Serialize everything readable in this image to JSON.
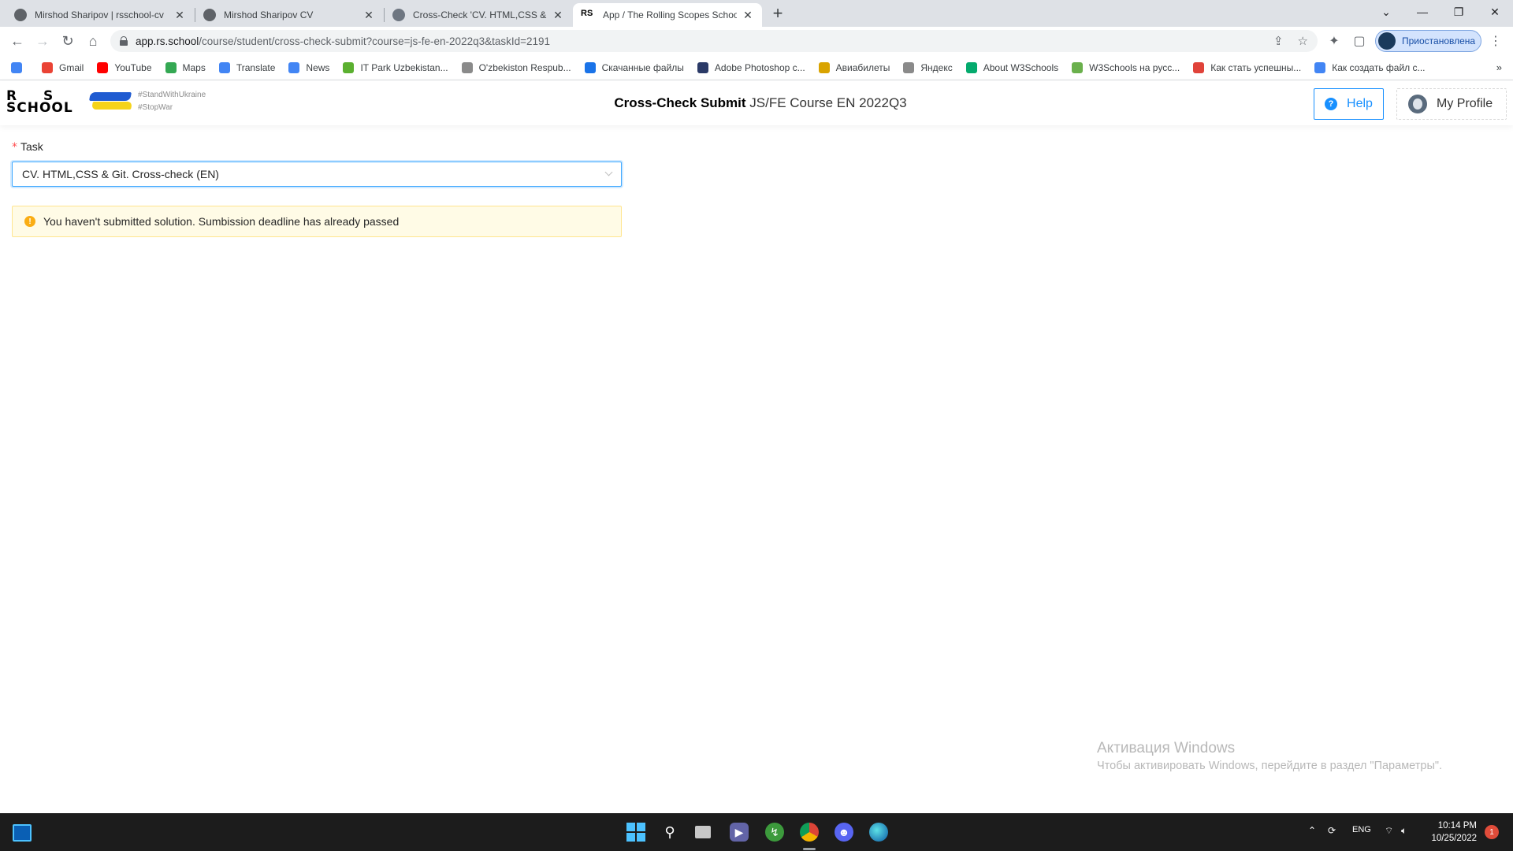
{
  "browser": {
    "tabs": [
      {
        "title": "Mirshod Sharipov | rsschool-cv",
        "active": false
      },
      {
        "title": "Mirshod Sharipov CV",
        "active": false
      },
      {
        "title": "Cross-Check 'CV. HTML,CSS & Gi",
        "active": false
      },
      {
        "title": "App / The Rolling Scopes School",
        "active": true
      }
    ],
    "url_host": "app.rs.school",
    "url_path": "/course/student/cross-check-submit?course=js-fe-en-2022q3&taskId=2191",
    "profile_status": "Приостановлена",
    "bookmarks": [
      {
        "label": "",
        "icon": "google-icon",
        "color": "#4285f4"
      },
      {
        "label": "Gmail",
        "icon": "gmail-icon",
        "color": "#ea4335"
      },
      {
        "label": "YouTube",
        "icon": "youtube-icon",
        "color": "#ff0000"
      },
      {
        "label": "Maps",
        "icon": "maps-icon",
        "color": "#34a853"
      },
      {
        "label": "Translate",
        "icon": "translate-icon",
        "color": "#4285f4"
      },
      {
        "label": "News",
        "icon": "news-icon",
        "color": "#4285f4"
      },
      {
        "label": "IT Park Uzbekistan...",
        "icon": "itpark-icon",
        "color": "#5bb030"
      },
      {
        "label": "O'zbekiston Respub...",
        "icon": "globe-icon",
        "color": "#8a8a8a"
      },
      {
        "label": "Скачанные файлы",
        "icon": "download-icon",
        "color": "#1a73e8"
      },
      {
        "label": "Adobe Photoshop c...",
        "icon": "photoshop-icon",
        "color": "#2b3a67"
      },
      {
        "label": "Авиабилеты",
        "icon": "plane-icon",
        "color": "#d9a300"
      },
      {
        "label": "Яндекс",
        "icon": "globe-icon",
        "color": "#8a8a8a"
      },
      {
        "label": "About W3Schools",
        "icon": "w3schools-icon",
        "color": "#04aa6d"
      },
      {
        "label": "W3Schools на русс...",
        "icon": "w3schools-ru-icon",
        "color": "#6ab04c"
      },
      {
        "label": "Как стать успешны...",
        "icon": "target-icon",
        "color": "#e0433a"
      },
      {
        "label": "Как создать файл с...",
        "icon": "google-icon",
        "color": "#4285f4"
      }
    ]
  },
  "app": {
    "logo_line1": "R S",
    "logo_line2": "SCHOOL",
    "tag1": "#StandWithUkraine",
    "tag2": "#StopWar",
    "title_bold": "Cross-Check Submit",
    "title_rest": " JS/FE Course EN 2022Q3",
    "help_label": "Help",
    "profile_label": "My Profile"
  },
  "form": {
    "task_label": "Task",
    "task_value": "CV. HTML,CSS & Git. Cross-check (EN)",
    "alert_text": "You haven't submitted solution. Sumbission deadline has already passed",
    "alert_color": "#faad14"
  },
  "watermark": {
    "title": "Активация Windows",
    "subtitle": "Чтобы активировать Windows, перейдите в раздел \"Параметры\"."
  },
  "taskbar": {
    "lang": "ENG",
    "time": "10:14 PM",
    "date": "10/25/2022",
    "notifications": "1"
  }
}
